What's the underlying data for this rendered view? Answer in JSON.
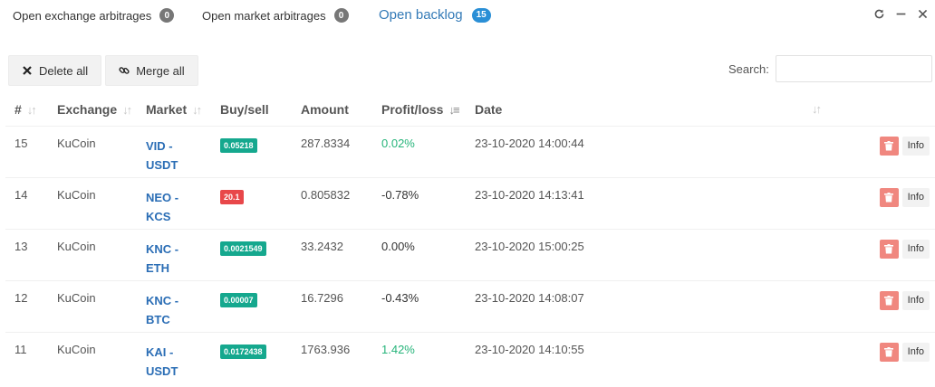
{
  "tabs": [
    {
      "label": "Open exchange arbitrages",
      "count": "0"
    },
    {
      "label": "Open market arbitrages",
      "count": "0"
    },
    {
      "label": "Open backlog",
      "count": "15",
      "active": true
    }
  ],
  "window": {
    "refresh_icon": "refresh-icon",
    "minimize_icon": "minimize-icon",
    "close_icon": "close-icon"
  },
  "toolbar": {
    "delete_all": "Delete all",
    "merge_all": "Merge all"
  },
  "search": {
    "label": "Search:",
    "value": ""
  },
  "table": {
    "headers": [
      "#",
      "Exchange",
      "Market",
      "Buy/sell",
      "Amount",
      "Profit/loss",
      "Date"
    ],
    "rows": [
      {
        "id": "15",
        "exchange": "KuCoin",
        "market_line1": "VID -",
        "market_line2": "USDT",
        "price": "0.05218",
        "side": "buy",
        "amount": "287.8334",
        "profit": "0.02%",
        "profit_sign": "pos",
        "date": "23-10-2020 14:00:44"
      },
      {
        "id": "14",
        "exchange": "KuCoin",
        "market_line1": "NEO -",
        "market_line2": "KCS",
        "price": "20.1",
        "side": "sell",
        "amount": "0.805832",
        "profit": "-0.78%",
        "profit_sign": "neg",
        "date": "23-10-2020 14:13:41"
      },
      {
        "id": "13",
        "exchange": "KuCoin",
        "market_line1": "KNC -",
        "market_line2": "ETH",
        "price": "0.0021549",
        "side": "buy",
        "amount": "33.2432",
        "profit": "0.00%",
        "profit_sign": "neg",
        "date": "23-10-2020 15:00:25"
      },
      {
        "id": "12",
        "exchange": "KuCoin",
        "market_line1": "KNC -",
        "market_line2": "BTC",
        "price": "0.00007",
        "side": "buy",
        "amount": "16.7296",
        "profit": "-0.43%",
        "profit_sign": "neg",
        "date": "23-10-2020 14:08:07"
      },
      {
        "id": "11",
        "exchange": "KuCoin",
        "market_line1": "KAI -",
        "market_line2": "USDT",
        "price": "0.0172438",
        "side": "buy",
        "amount": "1763.936",
        "profit": "1.42%",
        "profit_sign": "pos",
        "date": "23-10-2020 14:10:55"
      }
    ],
    "info_label": "Info"
  },
  "colors": {
    "accent": "#337ab7",
    "buy": "#15a88e",
    "sell": "#e8474a",
    "positive": "#26b47a",
    "delete": "#f0877f"
  }
}
